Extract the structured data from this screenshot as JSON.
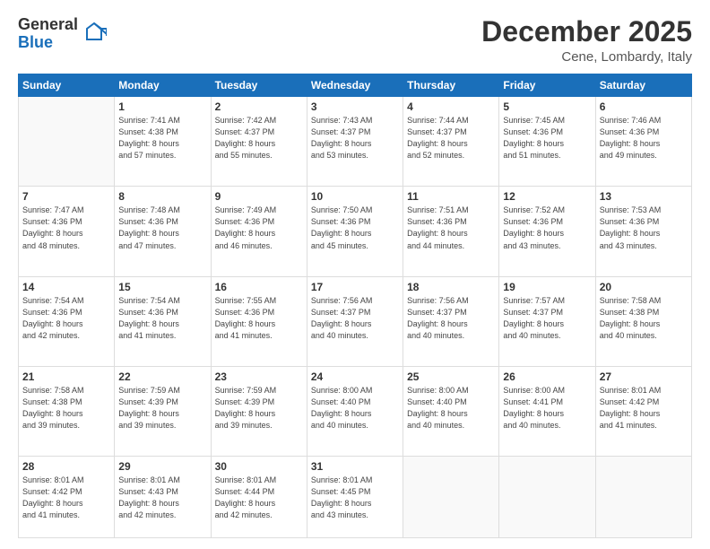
{
  "header": {
    "logo_general": "General",
    "logo_blue": "Blue",
    "title": "December 2025",
    "location": "Cene, Lombardy, Italy"
  },
  "days_of_week": [
    "Sunday",
    "Monday",
    "Tuesday",
    "Wednesday",
    "Thursday",
    "Friday",
    "Saturday"
  ],
  "weeks": [
    [
      {
        "day": "",
        "sunrise": "",
        "sunset": "",
        "daylight": ""
      },
      {
        "day": "1",
        "sunrise": "Sunrise: 7:41 AM",
        "sunset": "Sunset: 4:38 PM",
        "daylight": "Daylight: 8 hours and 57 minutes."
      },
      {
        "day": "2",
        "sunrise": "Sunrise: 7:42 AM",
        "sunset": "Sunset: 4:37 PM",
        "daylight": "Daylight: 8 hours and 55 minutes."
      },
      {
        "day": "3",
        "sunrise": "Sunrise: 7:43 AM",
        "sunset": "Sunset: 4:37 PM",
        "daylight": "Daylight: 8 hours and 53 minutes."
      },
      {
        "day": "4",
        "sunrise": "Sunrise: 7:44 AM",
        "sunset": "Sunset: 4:37 PM",
        "daylight": "Daylight: 8 hours and 52 minutes."
      },
      {
        "day": "5",
        "sunrise": "Sunrise: 7:45 AM",
        "sunset": "Sunset: 4:36 PM",
        "daylight": "Daylight: 8 hours and 51 minutes."
      },
      {
        "day": "6",
        "sunrise": "Sunrise: 7:46 AM",
        "sunset": "Sunset: 4:36 PM",
        "daylight": "Daylight: 8 hours and 49 minutes."
      }
    ],
    [
      {
        "day": "7",
        "sunrise": "Sunrise: 7:47 AM",
        "sunset": "Sunset: 4:36 PM",
        "daylight": "Daylight: 8 hours and 48 minutes."
      },
      {
        "day": "8",
        "sunrise": "Sunrise: 7:48 AM",
        "sunset": "Sunset: 4:36 PM",
        "daylight": "Daylight: 8 hours and 47 minutes."
      },
      {
        "day": "9",
        "sunrise": "Sunrise: 7:49 AM",
        "sunset": "Sunset: 4:36 PM",
        "daylight": "Daylight: 8 hours and 46 minutes."
      },
      {
        "day": "10",
        "sunrise": "Sunrise: 7:50 AM",
        "sunset": "Sunset: 4:36 PM",
        "daylight": "Daylight: 8 hours and 45 minutes."
      },
      {
        "day": "11",
        "sunrise": "Sunrise: 7:51 AM",
        "sunset": "Sunset: 4:36 PM",
        "daylight": "Daylight: 8 hours and 44 minutes."
      },
      {
        "day": "12",
        "sunrise": "Sunrise: 7:52 AM",
        "sunset": "Sunset: 4:36 PM",
        "daylight": "Daylight: 8 hours and 43 minutes."
      },
      {
        "day": "13",
        "sunrise": "Sunrise: 7:53 AM",
        "sunset": "Sunset: 4:36 PM",
        "daylight": "Daylight: 8 hours and 43 minutes."
      }
    ],
    [
      {
        "day": "14",
        "sunrise": "Sunrise: 7:54 AM",
        "sunset": "Sunset: 4:36 PM",
        "daylight": "Daylight: 8 hours and 42 minutes."
      },
      {
        "day": "15",
        "sunrise": "Sunrise: 7:54 AM",
        "sunset": "Sunset: 4:36 PM",
        "daylight": "Daylight: 8 hours and 41 minutes."
      },
      {
        "day": "16",
        "sunrise": "Sunrise: 7:55 AM",
        "sunset": "Sunset: 4:36 PM",
        "daylight": "Daylight: 8 hours and 41 minutes."
      },
      {
        "day": "17",
        "sunrise": "Sunrise: 7:56 AM",
        "sunset": "Sunset: 4:37 PM",
        "daylight": "Daylight: 8 hours and 40 minutes."
      },
      {
        "day": "18",
        "sunrise": "Sunrise: 7:56 AM",
        "sunset": "Sunset: 4:37 PM",
        "daylight": "Daylight: 8 hours and 40 minutes."
      },
      {
        "day": "19",
        "sunrise": "Sunrise: 7:57 AM",
        "sunset": "Sunset: 4:37 PM",
        "daylight": "Daylight: 8 hours and 40 minutes."
      },
      {
        "day": "20",
        "sunrise": "Sunrise: 7:58 AM",
        "sunset": "Sunset: 4:38 PM",
        "daylight": "Daylight: 8 hours and 40 minutes."
      }
    ],
    [
      {
        "day": "21",
        "sunrise": "Sunrise: 7:58 AM",
        "sunset": "Sunset: 4:38 PM",
        "daylight": "Daylight: 8 hours and 39 minutes."
      },
      {
        "day": "22",
        "sunrise": "Sunrise: 7:59 AM",
        "sunset": "Sunset: 4:39 PM",
        "daylight": "Daylight: 8 hours and 39 minutes."
      },
      {
        "day": "23",
        "sunrise": "Sunrise: 7:59 AM",
        "sunset": "Sunset: 4:39 PM",
        "daylight": "Daylight: 8 hours and 39 minutes."
      },
      {
        "day": "24",
        "sunrise": "Sunrise: 8:00 AM",
        "sunset": "Sunset: 4:40 PM",
        "daylight": "Daylight: 8 hours and 40 minutes."
      },
      {
        "day": "25",
        "sunrise": "Sunrise: 8:00 AM",
        "sunset": "Sunset: 4:40 PM",
        "daylight": "Daylight: 8 hours and 40 minutes."
      },
      {
        "day": "26",
        "sunrise": "Sunrise: 8:00 AM",
        "sunset": "Sunset: 4:41 PM",
        "daylight": "Daylight: 8 hours and 40 minutes."
      },
      {
        "day": "27",
        "sunrise": "Sunrise: 8:01 AM",
        "sunset": "Sunset: 4:42 PM",
        "daylight": "Daylight: 8 hours and 41 minutes."
      }
    ],
    [
      {
        "day": "28",
        "sunrise": "Sunrise: 8:01 AM",
        "sunset": "Sunset: 4:42 PM",
        "daylight": "Daylight: 8 hours and 41 minutes."
      },
      {
        "day": "29",
        "sunrise": "Sunrise: 8:01 AM",
        "sunset": "Sunset: 4:43 PM",
        "daylight": "Daylight: 8 hours and 42 minutes."
      },
      {
        "day": "30",
        "sunrise": "Sunrise: 8:01 AM",
        "sunset": "Sunset: 4:44 PM",
        "daylight": "Daylight: 8 hours and 42 minutes."
      },
      {
        "day": "31",
        "sunrise": "Sunrise: 8:01 AM",
        "sunset": "Sunset: 4:45 PM",
        "daylight": "Daylight: 8 hours and 43 minutes."
      },
      {
        "day": "",
        "sunrise": "",
        "sunset": "",
        "daylight": ""
      },
      {
        "day": "",
        "sunrise": "",
        "sunset": "",
        "daylight": ""
      },
      {
        "day": "",
        "sunrise": "",
        "sunset": "",
        "daylight": ""
      }
    ]
  ]
}
